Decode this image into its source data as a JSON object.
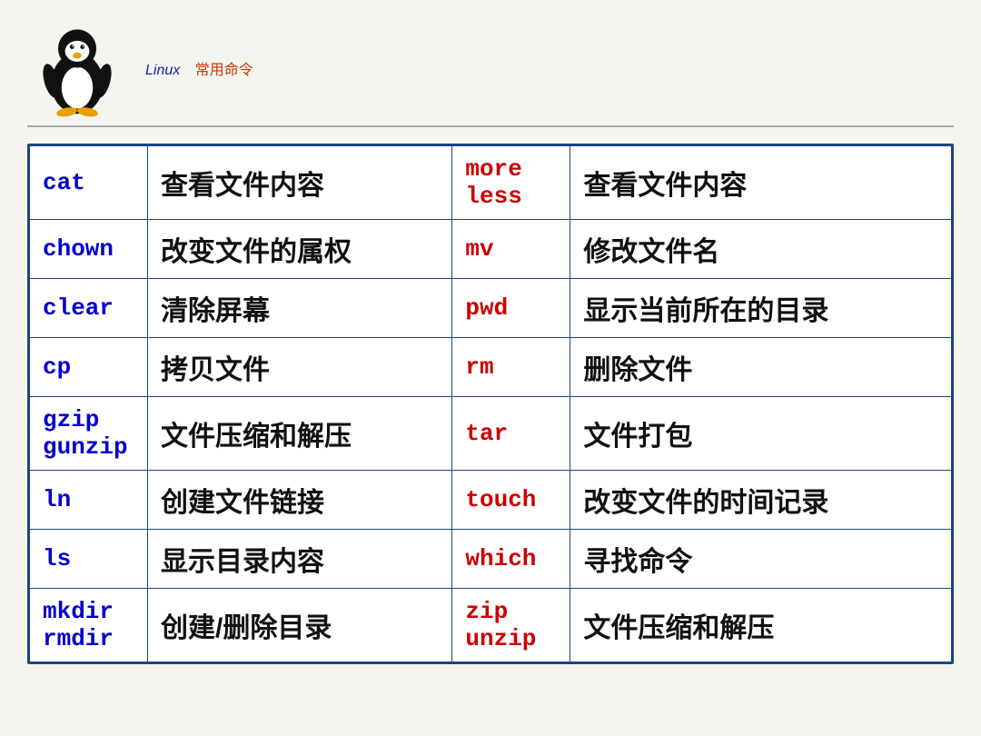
{
  "header": {
    "title_en": "Linux",
    "title_cn": "常用命令"
  },
  "rows": [
    {
      "cmd1": "cat",
      "desc1": "查看文件内容",
      "cmd2": "more\nless",
      "desc2": "查看文件内容"
    },
    {
      "cmd1": "chown",
      "desc1": "改变文件的属权",
      "cmd2": "mv",
      "desc2": "修改文件名"
    },
    {
      "cmd1": "clear",
      "desc1": "清除屏幕",
      "cmd2": "pwd",
      "desc2": "显示当前所在的目录"
    },
    {
      "cmd1": "cp",
      "desc1": "拷贝文件",
      "cmd2": "rm",
      "desc2": "删除文件"
    },
    {
      "cmd1": "gzip\ngunzip",
      "desc1": "文件压缩和解压",
      "cmd2": "tar",
      "desc2": "文件打包"
    },
    {
      "cmd1": "ln",
      "desc1": "创建文件链接",
      "cmd2": "touch",
      "desc2": "改变文件的时间记录"
    },
    {
      "cmd1": "ls",
      "desc1": "显示目录内容",
      "cmd2": "which",
      "desc2": "寻找命令"
    },
    {
      "cmd1": "mkdir\nrmdir",
      "desc1": "创建/删除目录",
      "cmd2": "zip\nunzip",
      "desc2": "文件压缩和解压"
    }
  ]
}
